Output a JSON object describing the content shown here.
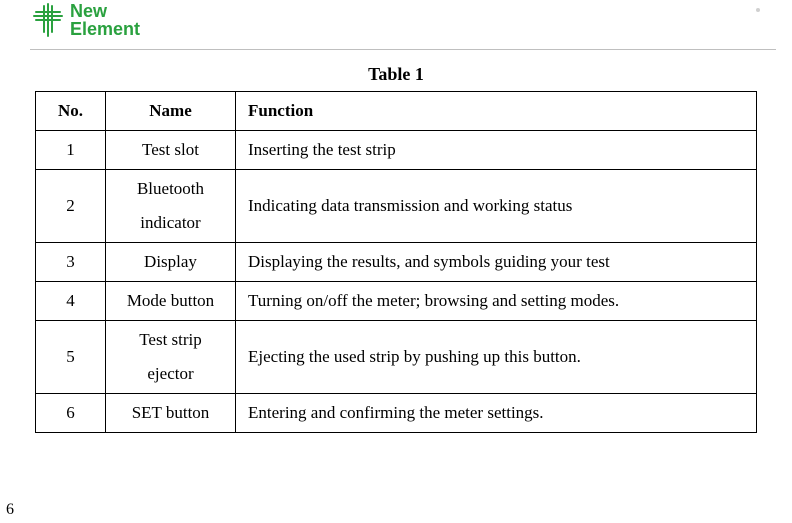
{
  "brand": {
    "line1": "New",
    "line2": "Element"
  },
  "table": {
    "caption": "Table 1",
    "headers": {
      "no": "No.",
      "name": "Name",
      "function": "Function"
    },
    "rows": [
      {
        "no": "1",
        "name": "Test slot",
        "function": "Inserting the test strip"
      },
      {
        "no": "2",
        "name": "Bluetooth indicator",
        "function": "Indicating data transmission and working status"
      },
      {
        "no": "3",
        "name": "Display",
        "function": "Displaying the results, and symbols guiding your test"
      },
      {
        "no": "4",
        "name": "Mode button",
        "function": "Turning on/off the meter; browsing and setting modes."
      },
      {
        "no": "5",
        "name": "Test strip ejector",
        "function": "Ejecting the used strip by pushing up this button."
      },
      {
        "no": "6",
        "name": "SET button",
        "function": "Entering and confirming the meter settings."
      }
    ]
  },
  "page_number": "6"
}
